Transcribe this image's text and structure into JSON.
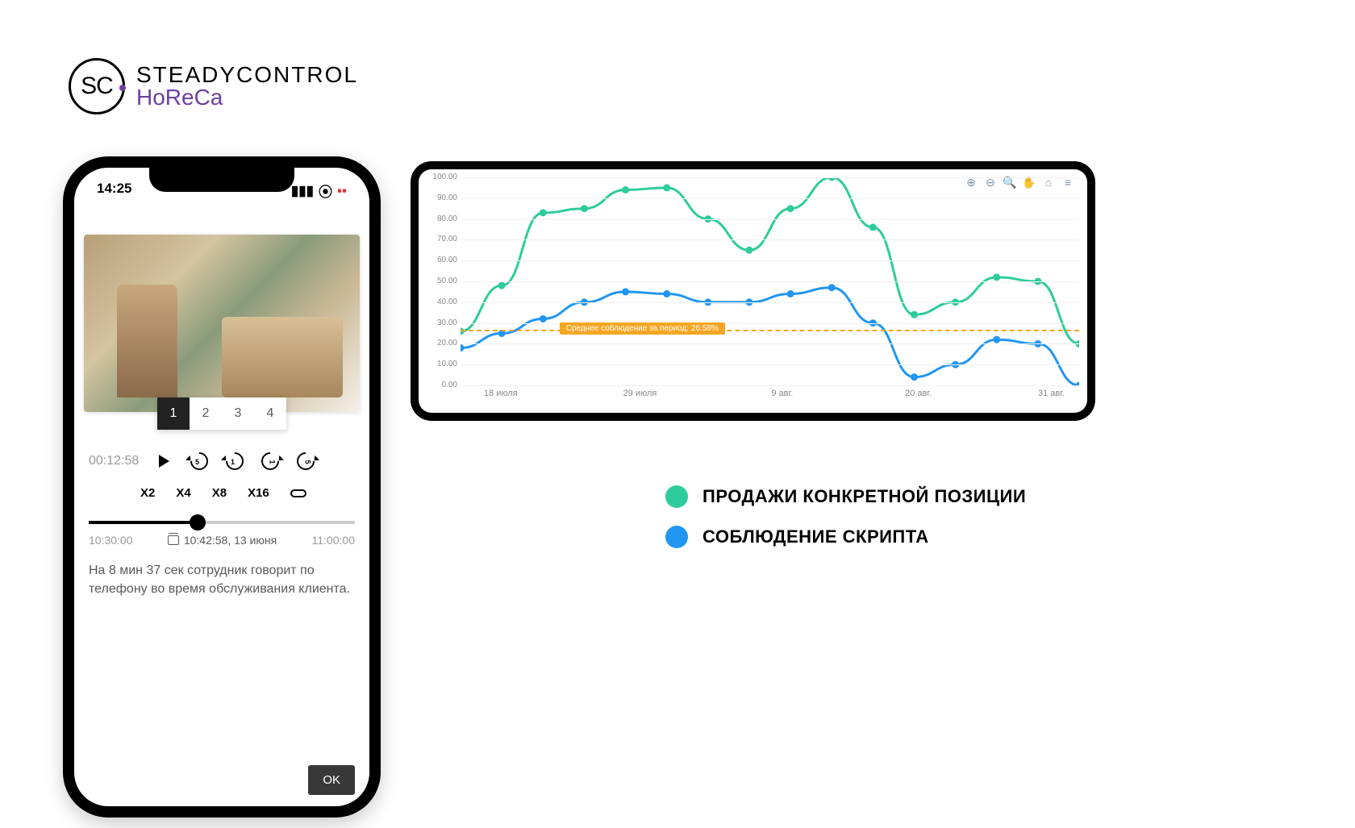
{
  "logo": {
    "circle": "SC",
    "line1": "STEADYCONTROL",
    "line2": "HoReCa"
  },
  "status_bar": {
    "time": "14:25"
  },
  "tabs": [
    "1",
    "2",
    "3",
    "4"
  ],
  "active_tab": "1",
  "player": {
    "elapsed": "00:12:58",
    "rewind_labels": [
      "5",
      "1"
    ],
    "forward_labels": [
      "1",
      "5"
    ],
    "speeds": [
      "X2",
      "X4",
      "X8",
      "X16"
    ]
  },
  "timeline": {
    "start": "10:30:00",
    "mid": "10:42:58, 13 июня",
    "end": "11:00:00"
  },
  "note": "На 8 мин 37 сек сотрудник говорит по телефону во время обслуживания клиента.",
  "ok": "OK",
  "legend": {
    "green": "ПРОДАЖИ КОНКРЕТНОЙ ПОЗИЦИИ",
    "blue": "СОБЛЮДЕНИЕ СКРИПТА"
  },
  "chart_ref_label": "Среднее соблюдение за период: 26.58%",
  "chart_data": {
    "type": "line",
    "ylim": [
      0,
      100
    ],
    "y_ticks": [
      "100.00",
      "90.00",
      "80.00",
      "70.00",
      "60.00",
      "50.00",
      "40.00",
      "30.00",
      "20.00",
      "10.00",
      "0.00"
    ],
    "x_ticks": [
      {
        "label": "18 июля",
        "pos": 0.065
      },
      {
        "label": "29 июля",
        "pos": 0.29
      },
      {
        "label": "9 авг.",
        "pos": 0.52
      },
      {
        "label": "20 авг.",
        "pos": 0.74
      },
      {
        "label": "31 авг.",
        "pos": 0.955
      }
    ],
    "reference_value": 26.58,
    "x": [
      0,
      1,
      2,
      3,
      4,
      5,
      6,
      7,
      8,
      9,
      10,
      11,
      12,
      13,
      14,
      15
    ],
    "series": [
      {
        "name": "Продажи конкретной позиции",
        "color": "#2ecc9b",
        "values": [
          26,
          48,
          83,
          85,
          94,
          95,
          80,
          65,
          85,
          100,
          76,
          34,
          40,
          52,
          50,
          20
        ]
      },
      {
        "name": "Соблюдение скрипта",
        "color": "#2196f3",
        "values": [
          18,
          25,
          32,
          40,
          45,
          44,
          40,
          40,
          44,
          47,
          30,
          4,
          10,
          22,
          20,
          0
        ]
      }
    ]
  }
}
